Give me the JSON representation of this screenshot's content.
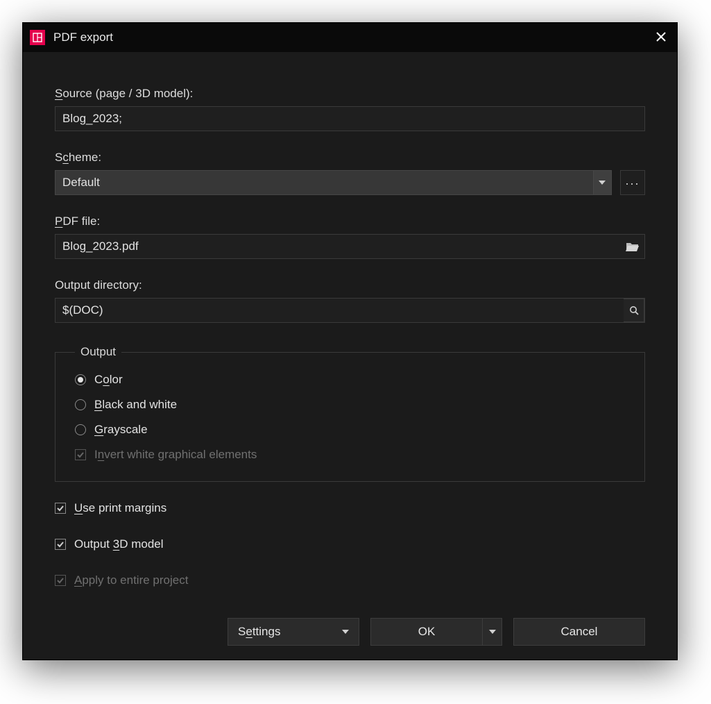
{
  "titlebar": {
    "title": "PDF export"
  },
  "source": {
    "label_pre": "S",
    "label_u": "",
    "label_post": "ource (page / 3D model):",
    "value": "Blog_2023;"
  },
  "scheme": {
    "label_pre": "S",
    "label_u": "c",
    "label_post": "heme:",
    "value": "Default"
  },
  "pdf_file": {
    "label_u": "P",
    "label_post": "DF file:",
    "value": "Blog_2023.pdf"
  },
  "output_dir": {
    "label": "Output directory:",
    "value": "$(DOC)"
  },
  "output_group": {
    "legend": "Output",
    "color": {
      "pre": "C",
      "u": "o",
      "post": "lor"
    },
    "bw": {
      "u": "B",
      "post": "lack and white"
    },
    "gray": {
      "u": "G",
      "post": "rayscale"
    },
    "invert": {
      "pre": "I",
      "u": "n",
      "post": "vert white graphical elements"
    }
  },
  "checks": {
    "margins": {
      "u": "U",
      "post": "se print margins"
    },
    "model3d": {
      "pre": "Output ",
      "u": "3",
      "post": "D model"
    },
    "apply": {
      "u": "A",
      "post": "pply to entire project"
    }
  },
  "buttons": {
    "settings": {
      "pre": "S",
      "u": "e",
      "post": "ttings"
    },
    "ok": "OK",
    "cancel": "Cancel"
  }
}
